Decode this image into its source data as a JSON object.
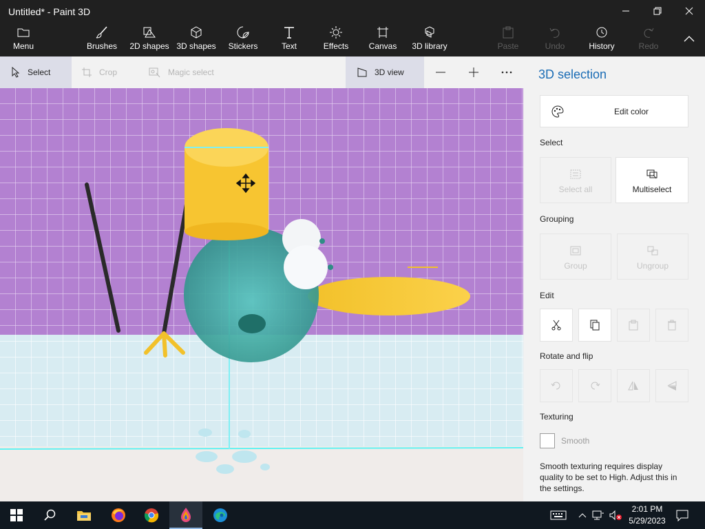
{
  "window": {
    "title": "Untitled* - Paint 3D",
    "controls": [
      "minimize-icon",
      "restore-icon",
      "close-icon"
    ]
  },
  "ribbon": {
    "menu_label": "Menu",
    "items": [
      {
        "label": "Brushes",
        "icon": "brush-icon",
        "enabled": true
      },
      {
        "label": "2D shapes",
        "icon": "2d-shapes-icon",
        "enabled": true
      },
      {
        "label": "3D shapes",
        "icon": "3d-cube-icon",
        "enabled": true
      },
      {
        "label": "Stickers",
        "icon": "sticker-icon",
        "enabled": true
      },
      {
        "label": "Text",
        "icon": "text-icon",
        "enabled": true
      },
      {
        "label": "Effects",
        "icon": "sun-icon",
        "enabled": true
      },
      {
        "label": "Canvas",
        "icon": "canvas-icon",
        "enabled": true
      },
      {
        "label": "3D library",
        "icon": "3d-library-icon",
        "enabled": true
      }
    ],
    "right": [
      {
        "label": "Paste",
        "icon": "paste-icon",
        "enabled": false
      },
      {
        "label": "Undo",
        "icon": "undo-icon",
        "enabled": false
      },
      {
        "label": "History",
        "icon": "history-icon",
        "enabled": true
      },
      {
        "label": "Redo",
        "icon": "redo-icon",
        "enabled": false
      }
    ]
  },
  "toolbar": {
    "select": "Select",
    "crop": "Crop",
    "magic_select": "Magic select",
    "view_3d": "3D view",
    "zoom_out_icon": "minus-icon",
    "zoom_in_icon": "plus-icon",
    "more_icon": "ellipsis-icon"
  },
  "panel": {
    "title": "3D selection",
    "edit_color": "Edit color",
    "select_heading": "Select",
    "select_all": "Select all",
    "multiselect": "Multiselect",
    "grouping_heading": "Grouping",
    "group": "Group",
    "ungroup": "Ungroup",
    "edit_heading": "Edit",
    "edit_icons": [
      "cut-icon",
      "copy-icon",
      "paste-icon",
      "delete-icon"
    ],
    "rotate_heading": "Rotate and flip",
    "rotate_icons": [
      "rotate-left-icon",
      "rotate-right-icon",
      "flip-horizontal-icon",
      "flip-vertical-icon"
    ],
    "texturing_heading": "Texturing",
    "smooth_label": "Smooth",
    "smooth_checked": false,
    "smooth_note": "Smooth texturing requires display quality to be set to High. Adjust this in the settings."
  },
  "taskbar": {
    "apps": [
      "start-icon",
      "search-icon",
      "file-explorer-icon",
      "firefox-icon",
      "chrome-icon",
      "paint3d-icon",
      "edge-icon"
    ],
    "time": "2:01 PM",
    "date": "5/29/2023"
  },
  "colors": {
    "accent": "#1a6cb5",
    "grid_purple": "#b381d1",
    "floor_blue": "#d8ecf2",
    "yellow": "#f7c531",
    "teal_body": "#2f9e92"
  }
}
